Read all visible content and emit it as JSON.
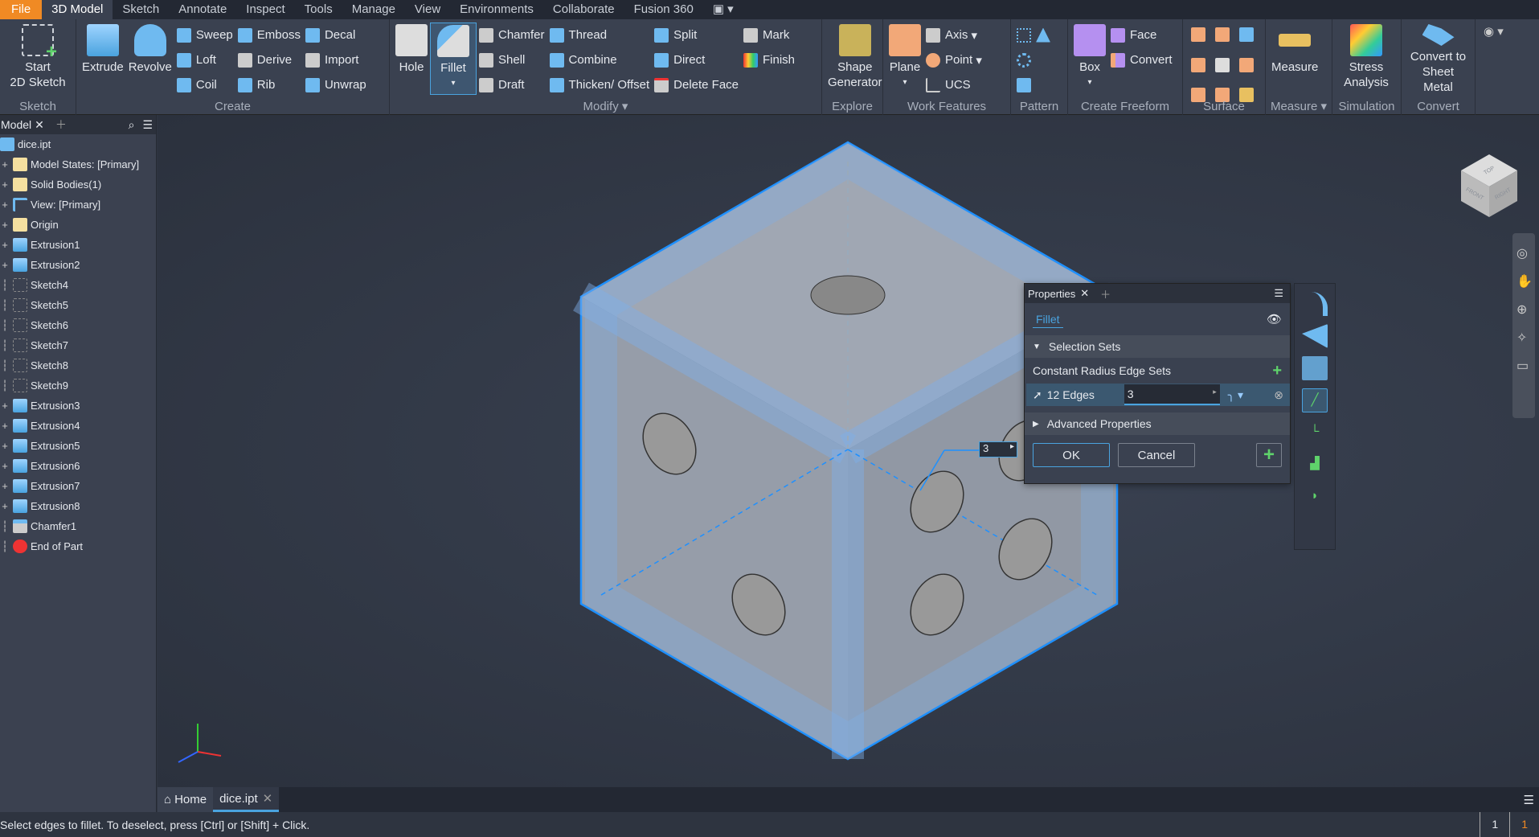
{
  "menu": {
    "tabs": [
      "File",
      "3D Model",
      "Sketch",
      "Annotate",
      "Inspect",
      "Tools",
      "Manage",
      "View",
      "Environments",
      "Collaborate",
      "Fusion 360"
    ],
    "active": "3D Model"
  },
  "ribbon": {
    "sketch": {
      "label": "Sketch",
      "start": "Start",
      "start2": "2D Sketch"
    },
    "create": {
      "label": "Create",
      "extrude": "Extrude",
      "revolve": "Revolve",
      "items": [
        "Sweep",
        "Loft",
        "Coil",
        "Emboss",
        "Derive",
        "Rib",
        "Decal",
        "Import",
        "Unwrap"
      ]
    },
    "modify": {
      "label": "Modify",
      "hole": "Hole",
      "fillet": "Fillet",
      "items": [
        "Chamfer",
        "Shell",
        "Draft",
        "Thread",
        "Combine",
        "Thicken/ Offset",
        "Split",
        "Direct",
        "Delete Face",
        "Mark",
        "Finish"
      ]
    },
    "explore": {
      "label": "Explore",
      "shape1": "Shape",
      "shape2": "Generator"
    },
    "work": {
      "label": "Work Features",
      "plane": "Plane",
      "items": [
        "Axis",
        "Point",
        "UCS"
      ]
    },
    "pattern": {
      "label": "Pattern"
    },
    "freeform": {
      "label": "Create Freeform",
      "box": "Box",
      "items": [
        "Face",
        "Convert"
      ]
    },
    "surface": {
      "label": "Surface"
    },
    "measure": {
      "label": "Measure",
      "measure": "Measure"
    },
    "simulation": {
      "label": "Simulation",
      "s1": "Stress",
      "s2": "Analysis"
    },
    "convert": {
      "label": "Convert",
      "c1": "Convert to",
      "c2": "Sheet Metal"
    }
  },
  "browser": {
    "tab": "Model",
    "root": "dice.ipt",
    "nodes": [
      {
        "label": "Model States: [Primary]",
        "type": "folder",
        "exp": true
      },
      {
        "label": "Solid Bodies(1)",
        "type": "folder",
        "exp": true
      },
      {
        "label": "View: [Primary]",
        "type": "view",
        "exp": true
      },
      {
        "label": "Origin",
        "type": "folder",
        "exp": true
      },
      {
        "label": "Extrusion1",
        "type": "extrude",
        "exp": true
      },
      {
        "label": "Extrusion2",
        "type": "extrude",
        "exp": true
      },
      {
        "label": "Sketch4",
        "type": "sketch",
        "exp": false
      },
      {
        "label": "Sketch5",
        "type": "sketch",
        "exp": false
      },
      {
        "label": "Sketch6",
        "type": "sketch",
        "exp": false
      },
      {
        "label": "Sketch7",
        "type": "sketch",
        "exp": false
      },
      {
        "label": "Sketch8",
        "type": "sketch",
        "exp": false
      },
      {
        "label": "Sketch9",
        "type": "sketch",
        "exp": false
      },
      {
        "label": "Extrusion3",
        "type": "extrude",
        "exp": true
      },
      {
        "label": "Extrusion4",
        "type": "extrude",
        "exp": true
      },
      {
        "label": "Extrusion5",
        "type": "extrude",
        "exp": true
      },
      {
        "label": "Extrusion6",
        "type": "extrude",
        "exp": true
      },
      {
        "label": "Extrusion7",
        "type": "extrude",
        "exp": true
      },
      {
        "label": "Extrusion8",
        "type": "extrude",
        "exp": true
      },
      {
        "label": "Chamfer1",
        "type": "chamfer",
        "exp": false
      },
      {
        "label": "End of Part",
        "type": "end",
        "exp": false
      }
    ]
  },
  "properties": {
    "tab": "Properties",
    "feature": "Fillet",
    "selection_sets": "Selection Sets",
    "constant_radius": "Constant Radius Edge Sets",
    "edges": "12 Edges",
    "radius": "3",
    "advanced": "Advanced Properties",
    "ok": "OK",
    "cancel": "Cancel"
  },
  "viewport": {
    "radius_tag": "3",
    "viewcube_front": "FRONT",
    "viewcube_right": "RIGHT",
    "viewcube_top": "TOP"
  },
  "doctabs": {
    "home": "Home",
    "doc": "dice.ipt"
  },
  "status": {
    "message": "Select edges to fillet. To deselect, press [Ctrl] or [Shift] + Click.",
    "count1": "1",
    "count2": "1"
  },
  "colors": {
    "accent": "#4aa3df",
    "file": "#f08a24",
    "green": "#5fd36b"
  }
}
